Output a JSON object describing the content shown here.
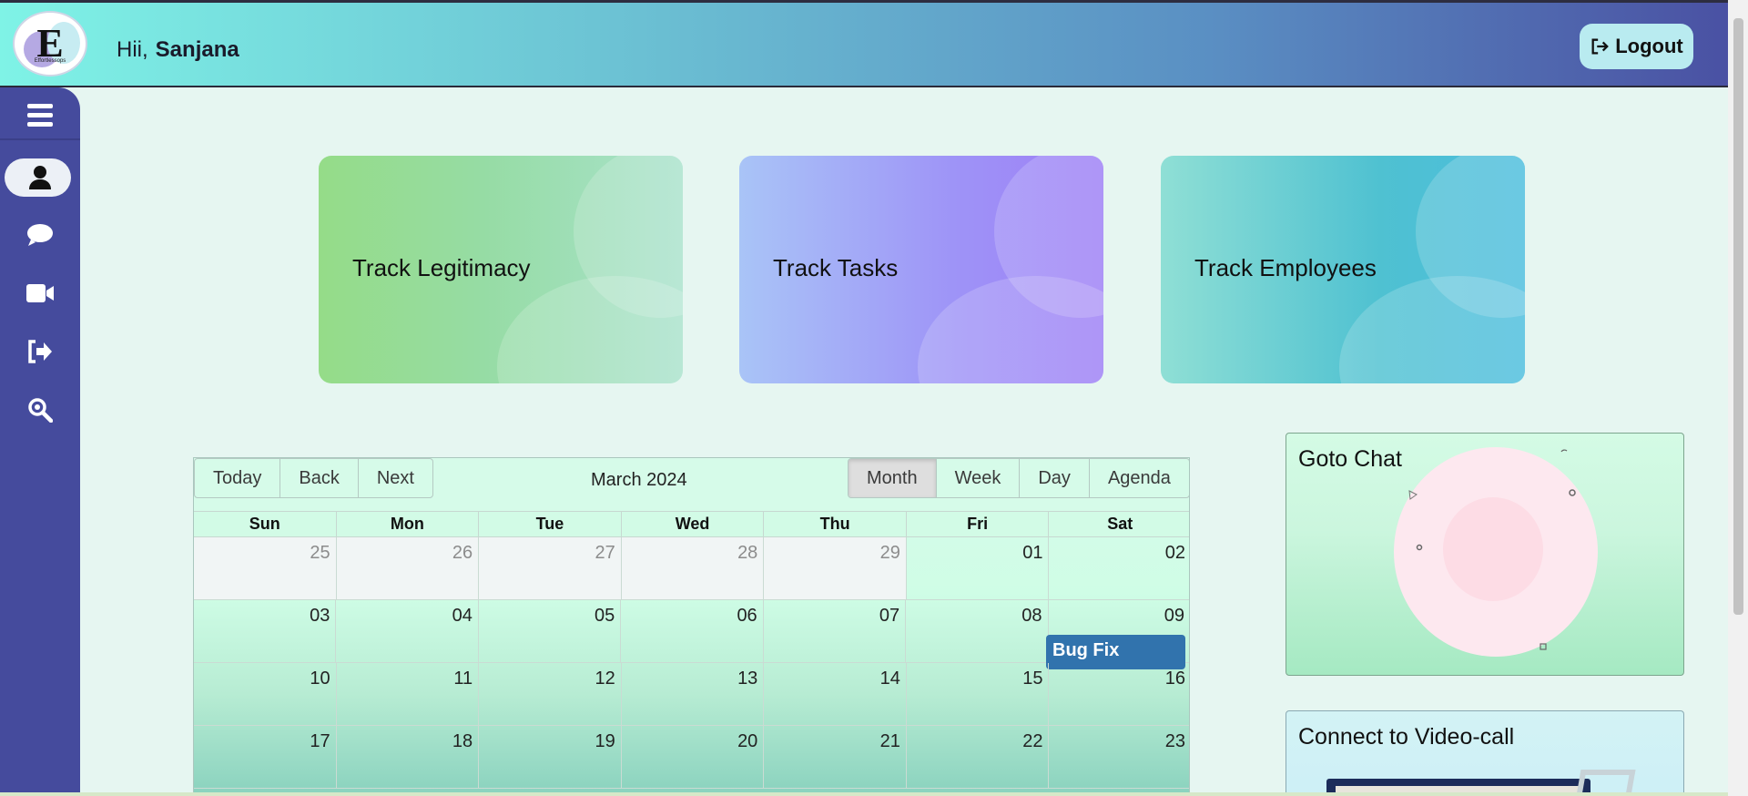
{
  "header": {
    "logo_letter": "E",
    "logo_caption": "Effortlessops",
    "greeting": "Hii,",
    "user_name": "Sanjana",
    "logout_label": "Logout"
  },
  "sidebar": {
    "items": [
      {
        "name": "menu-icon",
        "active": false
      },
      {
        "name": "profile-icon",
        "active": true
      },
      {
        "name": "chat-icon",
        "active": false
      },
      {
        "name": "video-icon",
        "active": false
      },
      {
        "name": "signout-icon",
        "active": false
      },
      {
        "name": "search-icon",
        "active": false
      }
    ]
  },
  "cards": [
    {
      "label": "Track Legitimacy"
    },
    {
      "label": "Track Tasks"
    },
    {
      "label": "Track Employees"
    }
  ],
  "calendar": {
    "toolbar_left": [
      "Today",
      "Back",
      "Next"
    ],
    "label": "March 2024",
    "views": [
      "Month",
      "Week",
      "Day",
      "Agenda"
    ],
    "active_view": "Month",
    "days_of_week": [
      "Sun",
      "Mon",
      "Tue",
      "Wed",
      "Thu",
      "Fri",
      "Sat"
    ],
    "weeks": [
      [
        "25",
        "26",
        "27",
        "28",
        "29",
        "01",
        "02"
      ],
      [
        "03",
        "04",
        "05",
        "06",
        "07",
        "08",
        "09"
      ],
      [
        "10",
        "11",
        "12",
        "13",
        "14",
        "15",
        "16"
      ],
      [
        "17",
        "18",
        "19",
        "20",
        "21",
        "22",
        "23"
      ]
    ],
    "event": {
      "title": "Bug Fix",
      "date": "09",
      "color": "#3173ad"
    }
  },
  "panels": {
    "chat_title": "Goto Chat",
    "video_title": "Connect to Video-call"
  },
  "colors": {
    "sidebar": "#454b9d",
    "accent": "#3173ad"
  }
}
